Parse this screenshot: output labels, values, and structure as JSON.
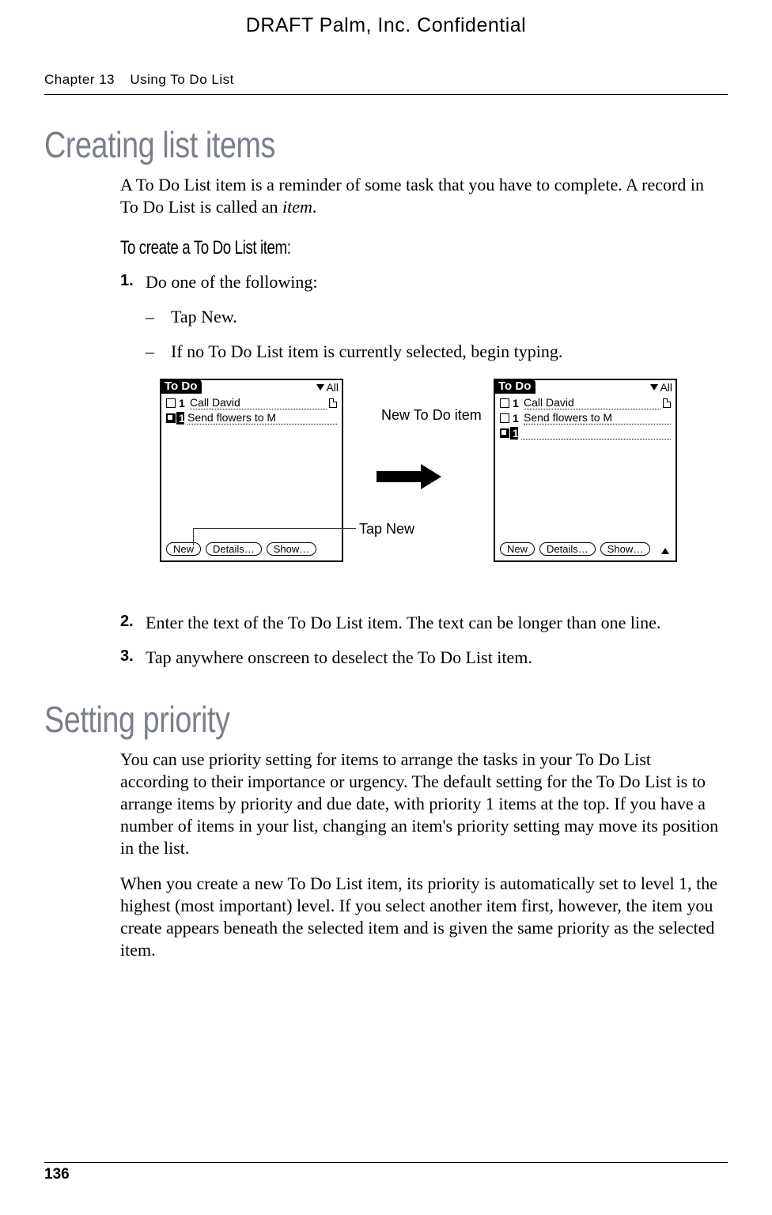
{
  "header": {
    "draft": "DRAFT   Palm, Inc. Confidential",
    "chapter": "Chapter 13",
    "chapter_title": "Using To Do List"
  },
  "section1": {
    "title": "Creating list items",
    "intro_a": "A To Do List item is a reminder of some task that you have to complete. A record in To Do List is called an ",
    "intro_b": "item",
    "intro_c": ".",
    "subhead": "To create a To Do List item:",
    "step1_num": "1.",
    "step1_text": "Do one of the following:",
    "bullet1": "Tap New.",
    "bullet2": "If no To Do List item is currently selected, begin typing.",
    "step2_num": "2.",
    "step2_text": "Enter the text of the To Do List item. The text can be longer than one line.",
    "step3_num": "3.",
    "step3_text": "Tap anywhere onscreen to deselect the To Do List item."
  },
  "figure": {
    "screen_title": "To Do",
    "category": "All",
    "row1_pri": "1",
    "row1_text": "Call David",
    "row2_pri": "1",
    "row2_text": "Send flowers to M",
    "btn_new": "New",
    "btn_details": "Details…",
    "btn_show": "Show…",
    "label_new_item": "New To Do item",
    "label_tap_new": "Tap New"
  },
  "section2": {
    "title": "Setting priority",
    "p1": "You can use priority setting for items to arrange the tasks in your To Do List according to their importance or urgency. The default setting for the To Do List is to arrange items by priority and due date, with priority 1 items at the top. If you have a number of items in your list, changing an item's priority setting may move its position in the list.",
    "p2": "When you create a new To Do List item, its priority is automatically set to level 1, the highest (most important) level. If you select another item first, however, the item you create appears beneath the selected item and is given the same priority as the selected item."
  },
  "footer": {
    "page": "136"
  }
}
